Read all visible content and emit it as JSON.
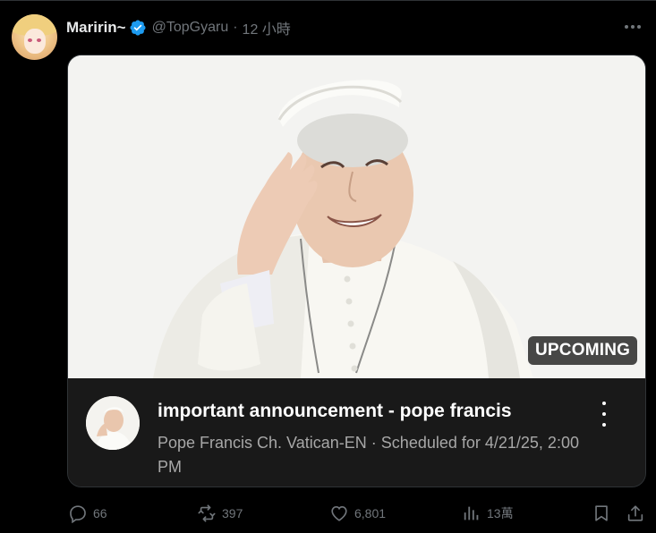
{
  "tweet": {
    "display_name": "Maririn~",
    "handle": "@TopGyaru",
    "separator": "·",
    "time": "12 小時"
  },
  "card": {
    "badge": "UPCOMING",
    "title": "important announcement - pope francis",
    "channel": "Pope Francis Ch. Vatican-EN",
    "meta_separator": "·",
    "scheduled": "Scheduled for 4/21/25, 2:00 PM"
  },
  "actions": {
    "replies": "66",
    "reposts": "397",
    "likes": "6,801",
    "views": "13萬"
  },
  "colors": {
    "background": "#000000",
    "muted": "#71767b",
    "verified": "#1d9bf0",
    "card_info_bg": "#191919"
  },
  "icons": [
    "verified-icon",
    "more-icon",
    "kebab-icon",
    "reply-icon",
    "repost-icon",
    "like-icon",
    "views-icon",
    "bookmark-icon",
    "share-icon"
  ]
}
